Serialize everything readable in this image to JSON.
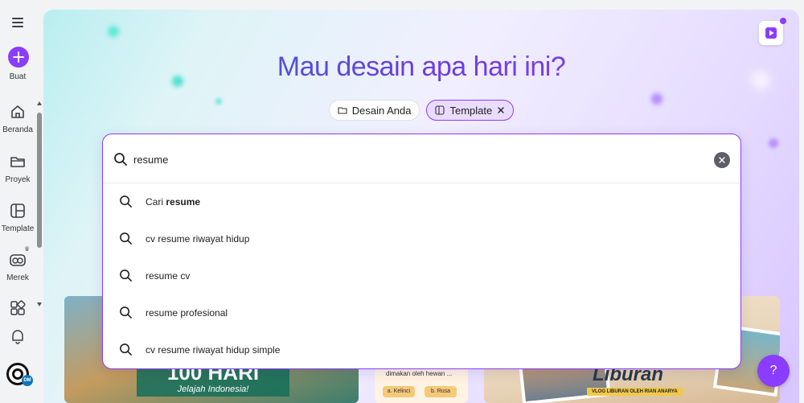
{
  "sidebar": {
    "create_label": "Buat",
    "items": [
      {
        "label": "Beranda",
        "icon": "home-icon"
      },
      {
        "label": "Proyek",
        "icon": "folder-icon"
      },
      {
        "label": "Template",
        "icon": "template-icon"
      },
      {
        "label": "Merek",
        "icon": "brand-icon"
      },
      {
        "label": "",
        "icon": "apps-icon"
      },
      {
        "label": "",
        "icon": "bell-icon"
      }
    ],
    "avatar_badge": "DM"
  },
  "hero": {
    "title": "Mau desain apa hari ini?",
    "filters": [
      {
        "label": "Desain Anda",
        "active": false
      },
      {
        "label": "Template",
        "active": true
      }
    ]
  },
  "search": {
    "value": "resume",
    "suggestions": [
      {
        "prefix": "Cari ",
        "bold": "resume"
      },
      {
        "prefix": "cv resume riwayat hidup",
        "bold": ""
      },
      {
        "prefix": "resume cv",
        "bold": ""
      },
      {
        "prefix": "resume profesional",
        "bold": ""
      },
      {
        "prefix": "cv resume riwayat hidup simple",
        "bold": ""
      }
    ]
  },
  "thumbnails": {
    "t1_title": "100 HARI",
    "t1_sub": "Jelajah Indonesia!",
    "t2_text": "dimakan oleh hewan ...",
    "t2_opt_a": "a. Kelinci",
    "t2_opt_b": "b. Rusa",
    "t3_title": "Liburan",
    "t3_sub": "VLOG LIBURAN OLEH RIAN ANARYA"
  },
  "help": {
    "label": "?"
  },
  "colors": {
    "accent": "#8b3dff",
    "title_start": "#2d68d6",
    "title_end": "#8b3dff"
  }
}
